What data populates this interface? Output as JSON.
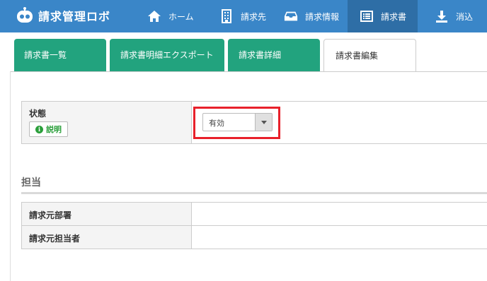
{
  "app": {
    "title": "請求管理ロボ"
  },
  "nav": {
    "items": [
      {
        "label": "ホーム",
        "icon": "home-icon"
      },
      {
        "label": "請求先",
        "icon": "building-icon"
      },
      {
        "label": "請求情報",
        "icon": "inbox-icon"
      },
      {
        "label": "請求書",
        "icon": "list-icon",
        "active": true
      },
      {
        "label": "消込",
        "icon": "download-icon"
      }
    ]
  },
  "tabs": [
    {
      "label": "請求書一覧"
    },
    {
      "label": "請求書明細エクスポート"
    },
    {
      "label": "請求書詳細"
    },
    {
      "label": "請求書編集",
      "current": true
    }
  ],
  "status": {
    "label": "状態",
    "help_label": "説明",
    "select_value": "有効"
  },
  "assignee": {
    "section_title": "担当",
    "rows": [
      {
        "label": "請求元部署",
        "value": ""
      },
      {
        "label": "請求元担当者",
        "value": ""
      }
    ]
  },
  "colors": {
    "nav_bg": "#3a86c8",
    "nav_active": "#2e6ea6",
    "tab_green": "#22a37e",
    "highlight": "#e8202a",
    "help_green": "#2a9f3a"
  }
}
